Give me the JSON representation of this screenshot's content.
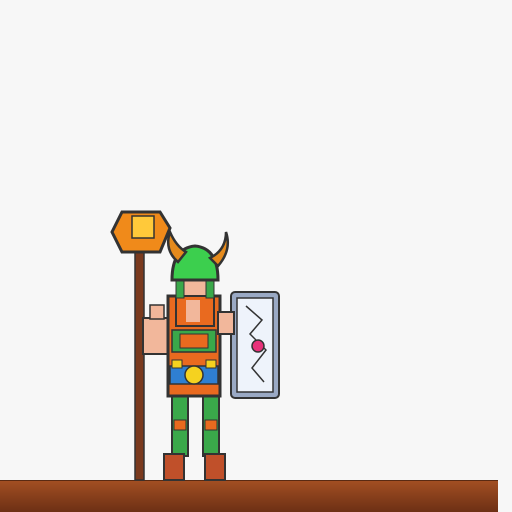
{
  "scene": {
    "sky_color": "#f7f7f7",
    "ground_color": "#a24f22",
    "ground_dark": "#6b2f14"
  },
  "character": {
    "type": "viking-warrior",
    "helmet_color": "#3ccf4e",
    "horn_color": "#e58a1c",
    "skin_color": "#f2b79b",
    "tunic_color": "#e96a1f",
    "belt_color": "#2f7fd1",
    "accent_yellow": "#f5d21f",
    "leg_color": "#3aa84a",
    "boot_color": "#c0502a",
    "outline_color": "#333333"
  },
  "weapon": {
    "type": "hammer-staff",
    "head_color": "#f08a1a",
    "head_inner_color": "#ffc93a",
    "shaft_color": "#7a3a1e"
  },
  "shield": {
    "type": "tower-shield",
    "face_color": "#eef3fb",
    "rim_color": "#9aa9c4",
    "gem_color": "#e8327a"
  }
}
